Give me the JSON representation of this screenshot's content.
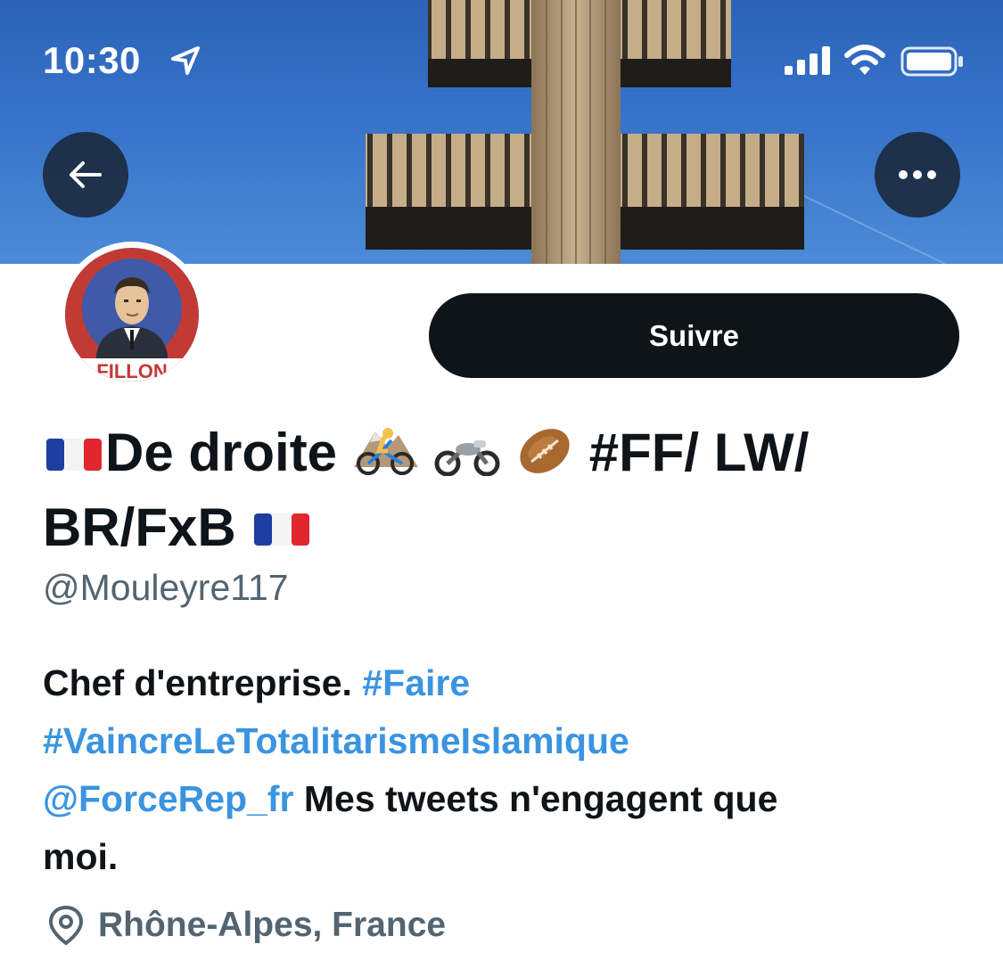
{
  "status_bar": {
    "time": "10:30"
  },
  "banner": {
    "background_color": "#3673c9",
    "image_subject": "cross-of-lorraine-monument"
  },
  "header_actions": {
    "back_icon": "arrow-left-icon",
    "more_icon": "ellipsis-icon"
  },
  "avatar": {
    "lettering": "FILLON"
  },
  "profile": {
    "follow_label": "Suivre",
    "name_prefix": "De droite",
    "name_tags": "#FF/ LW/",
    "name_line2": "BR/FxB",
    "name_emojis": [
      "flag-france-icon",
      "mountain-biker-icon",
      "motorcycle-icon",
      "rugby-ball-icon",
      "flag-france-icon"
    ],
    "handle": "@Mouleyre117",
    "bio": {
      "text1": "Chef d'entreprise.",
      "hashtag1": "#Faire",
      "hashtag2": "#VaincreLeTotalitarismeIslamique",
      "mention": "@ForceRep_fr",
      "text2": "Mes tweets n'engagent que",
      "text3": "moi."
    },
    "location": "Rhône-Alpes, France",
    "link_color": "#1d9bf0",
    "muted_color": "#536471"
  }
}
